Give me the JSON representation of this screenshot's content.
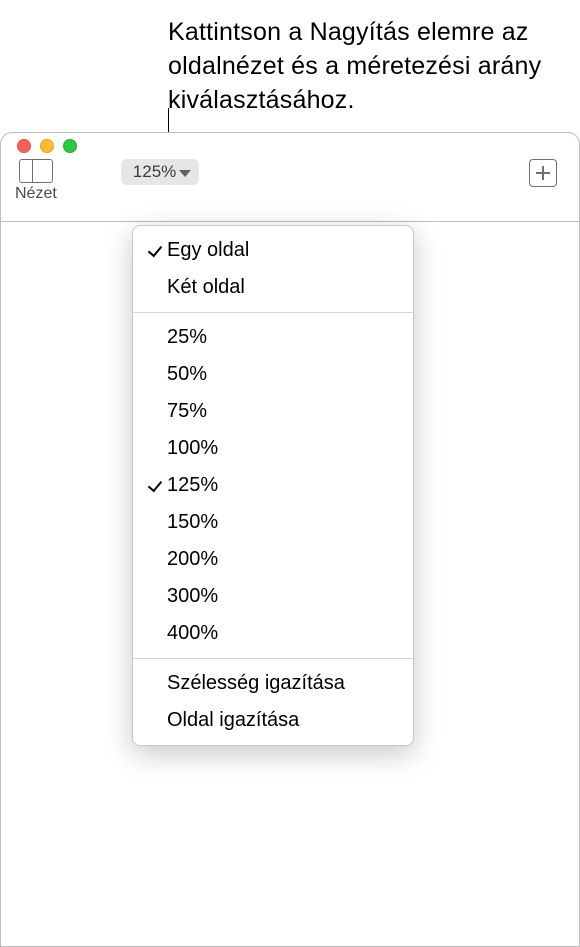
{
  "callout": {
    "text": "Kattintson a Nagyítás elemre az oldalnézet és a méretezési arány kiválasztásához."
  },
  "toolbar": {
    "view_label": "Nézet",
    "zoom_value": "125%"
  },
  "menu": {
    "page_options": [
      {
        "label": "Egy oldal",
        "checked": true
      },
      {
        "label": "Két oldal",
        "checked": false
      }
    ],
    "zoom_levels": [
      {
        "label": "25%",
        "checked": false
      },
      {
        "label": "50%",
        "checked": false
      },
      {
        "label": "75%",
        "checked": false
      },
      {
        "label": "100%",
        "checked": false
      },
      {
        "label": "125%",
        "checked": true
      },
      {
        "label": "150%",
        "checked": false
      },
      {
        "label": "200%",
        "checked": false
      },
      {
        "label": "300%",
        "checked": false
      },
      {
        "label": "400%",
        "checked": false
      }
    ],
    "fit_options": [
      {
        "label": "Szélesség igazítása"
      },
      {
        "label": "Oldal igazítása"
      }
    ]
  }
}
